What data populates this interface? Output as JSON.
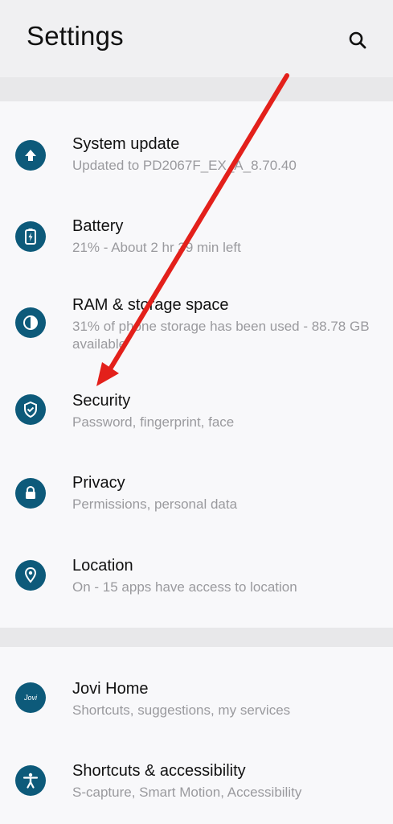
{
  "header": {
    "title": "Settings",
    "search_icon": "search-icon"
  },
  "colors": {
    "accent": "#0d5a7a",
    "annotation_arrow": "#e3201b"
  },
  "items": [
    {
      "label": "System update",
      "sub": "Updated to PD2067F_EX_A_8.70.40",
      "icon": "arrow-up-icon"
    },
    {
      "label": "Battery",
      "sub": "21% - About 2 hr 39 min left",
      "icon": "battery-icon"
    },
    {
      "label": "RAM & storage space",
      "sub": "31% of phone storage has been used - 88.78 GB available",
      "icon": "storage-pie-icon"
    },
    {
      "label": "Security",
      "sub": "Password, fingerprint, face",
      "icon": "shield-icon"
    },
    {
      "label": "Privacy",
      "sub": "Permissions, personal data",
      "icon": "lock-icon"
    },
    {
      "label": "Location",
      "sub": "On - 15 apps have access to location",
      "icon": "location-pin-icon"
    },
    {
      "label": "Jovi Home",
      "sub": "Shortcuts, suggestions, my services",
      "icon": "jovi-icon",
      "icon_text": "Jovi"
    },
    {
      "label": "Shortcuts & accessibility",
      "sub": "S-capture, Smart Motion, Accessibility",
      "icon": "accessibility-icon"
    }
  ]
}
